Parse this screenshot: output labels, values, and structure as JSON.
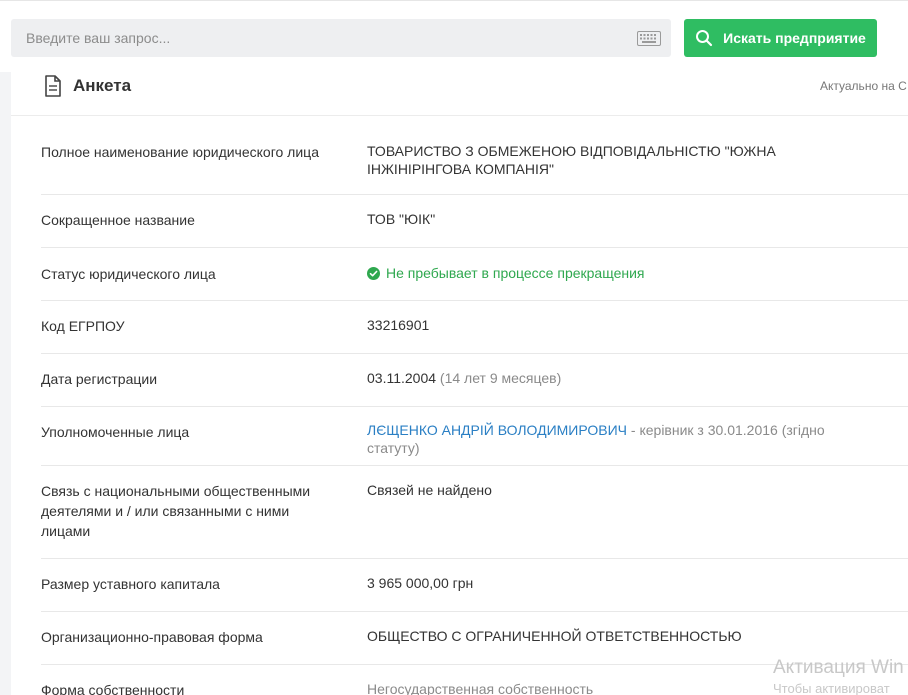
{
  "search": {
    "placeholder": "Введите ваш запрос...",
    "button_label": "Искать предприятие"
  },
  "card": {
    "title": "Анкета",
    "actual_text": "Актуально на С"
  },
  "rows": [
    {
      "label": "Полное наименование юридического лица",
      "value": "ТОВАРИСТВО З ОБМЕЖЕНОЮ ВІДПОВІДАЛЬНІСТЮ \"ЮЖНА ІНЖІНІРІНГОВА КОМПАНІЯ\""
    },
    {
      "label": "Сокращенное название",
      "value": "ТОВ \"ЮІК\""
    },
    {
      "label": "Статус юридического лица",
      "value": "Не пребывает в процессе прекращения"
    },
    {
      "label": "Код ЕГРПОУ",
      "value": "33216901"
    },
    {
      "label": "Дата регистрации",
      "value": "03.11.2004",
      "extra": "(14 лет 9 месяцев)"
    },
    {
      "label": "Уполномоченные лица",
      "link": "ЛЄЩЕНКО АНДРІЙ ВОЛОДИМИРОВИЧ",
      "extra": "- керівник з 30.01.2016 (згідно статуту)"
    },
    {
      "label": "Связь с национальными общественными деятелями и / или связанными с ними лицами",
      "value": "Связей не найдено"
    },
    {
      "label": "Размер уставного капитала",
      "value": "3 965 000,00 грн"
    },
    {
      "label": "Организационно-правовая форма",
      "value": "ОБЩЕСТВО С ОГРАНИЧЕННОЙ ОТВЕТСТВЕННОСТЬЮ"
    },
    {
      "label": "Форма собственности",
      "value": "Негосударственная собственность"
    }
  ],
  "watermark": {
    "line1": "Активация Win",
    "line2": "Чтобы активироват"
  },
  "colors": {
    "accent": "#2fbd62",
    "status_green": "#2fa84f",
    "link": "#2a7fc4"
  },
  "icons": [
    "search-icon",
    "keyboard-icon",
    "document-icon",
    "check-circle-icon"
  ]
}
